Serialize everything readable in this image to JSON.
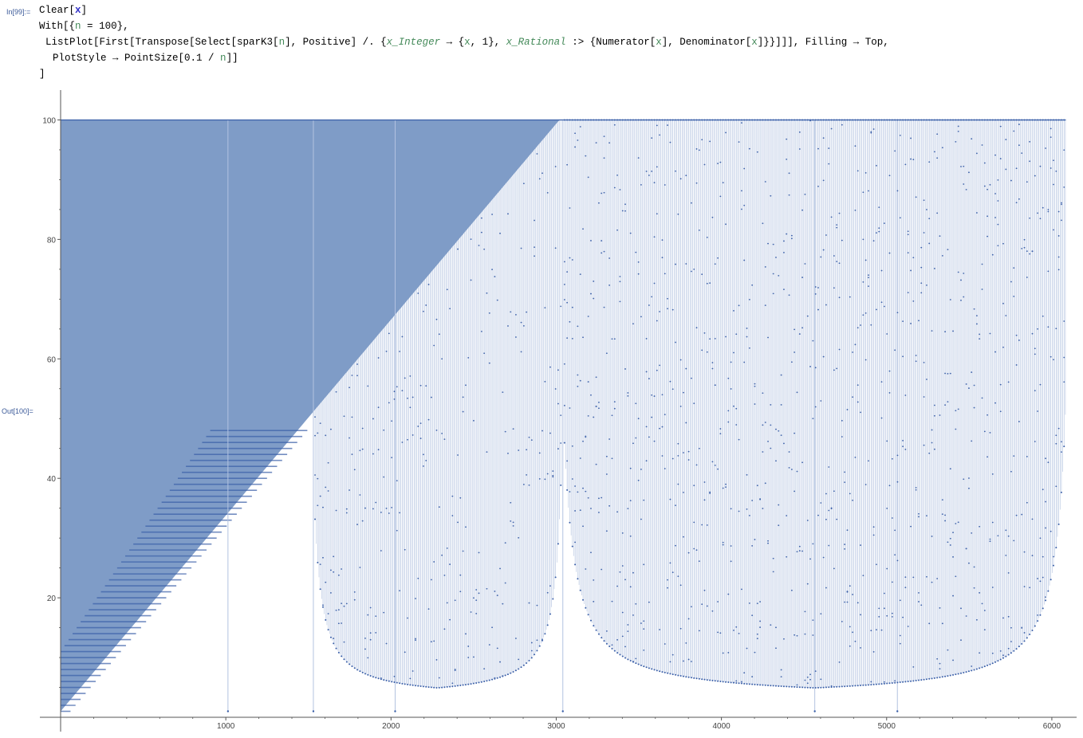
{
  "input_label": "In[99]:=",
  "output_label": "Out[100]=",
  "code": {
    "line1": {
      "fn": "Clear",
      "arg": "x"
    },
    "line2": {
      "fn": "With",
      "var": "n",
      "eq": " = ",
      "val": "100"
    },
    "line3": {
      "pre": "ListPlot[First[Transpose[Select[sparK3[",
      "n": "n",
      "mid1": "], Positive] /. {",
      "pat1": "x_Integer",
      "arrow1": " → {",
      "x1": "x",
      "mid2": ", 1}, ",
      "pat2": "x_Rational",
      "arrow2": " :> {Numerator[",
      "x2": "x",
      "mid3": "], Denominator[",
      "x3": "x",
      "end": "]}}]]], Filling → Top,"
    },
    "line4": {
      "pre": "PlotStyle → PointSize[0.1 / ",
      "n": "n",
      "end": "]]"
    },
    "line5": "]"
  },
  "chart_data": {
    "type": "scatter",
    "description_free": true,
    "filling": "Top",
    "x_ticks": [
      "1000",
      "2000",
      "3000",
      "4000",
      "5000",
      "6000"
    ],
    "y_ticks": [
      "20",
      "40",
      "60",
      "80",
      "100"
    ],
    "xlim": [
      0,
      6150
    ],
    "ylim": [
      0,
      105
    ],
    "n": 100,
    "colors": {
      "fill": "#7f9cc7",
      "stem": "#b3c3e0",
      "point": "#3a5fa8",
      "axis": "#555555"
    },
    "dense_region_end_x": 3040,
    "max_x": 6085,
    "max_y": 100
  }
}
